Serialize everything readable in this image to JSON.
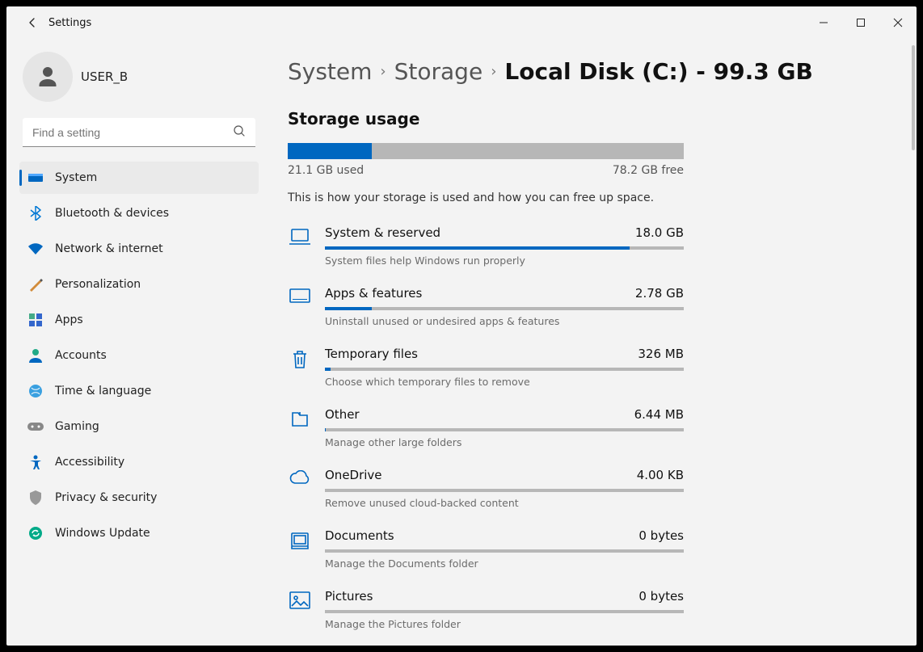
{
  "app_title": "Settings",
  "user": {
    "name": "USER_B"
  },
  "search": {
    "placeholder": "Find a setting"
  },
  "sidebar": {
    "items": [
      {
        "label": "System"
      },
      {
        "label": "Bluetooth & devices"
      },
      {
        "label": "Network & internet"
      },
      {
        "label": "Personalization"
      },
      {
        "label": "Apps"
      },
      {
        "label": "Accounts"
      },
      {
        "label": "Time & language"
      },
      {
        "label": "Gaming"
      },
      {
        "label": "Accessibility"
      },
      {
        "label": "Privacy & security"
      },
      {
        "label": "Windows Update"
      }
    ]
  },
  "breadcrumb": [
    {
      "text": "System"
    },
    {
      "text": "Storage"
    },
    {
      "text": "Local Disk (C:) - 99.3 GB"
    }
  ],
  "usage": {
    "section_title": "Storage usage",
    "used_label": "21.1 GB used",
    "free_label": "78.2 GB free",
    "desc": "This is how your storage is used and how you can free up space.",
    "fill_pct": 21.2
  },
  "categories": [
    {
      "title": "System & reserved",
      "size": "18.0 GB",
      "pct": 85,
      "desc": "System files help Windows run properly",
      "icon": "laptop"
    },
    {
      "title": "Apps & features",
      "size": "2.78 GB",
      "pct": 13,
      "desc": "Uninstall unused or undesired apps & features",
      "icon": "apps"
    },
    {
      "title": "Temporary files",
      "size": "326 MB",
      "pct": 1.5,
      "desc": "Choose which temporary files to remove",
      "icon": "trash"
    },
    {
      "title": "Other",
      "size": "6.44 MB",
      "pct": 0.2,
      "desc": "Manage other large folders",
      "icon": "folder"
    },
    {
      "title": "OneDrive",
      "size": "4.00 KB",
      "pct": 0,
      "desc": "Remove unused cloud-backed content",
      "icon": "cloud"
    },
    {
      "title": "Documents",
      "size": "0 bytes",
      "pct": 0,
      "desc": "Manage the Documents folder",
      "icon": "document"
    },
    {
      "title": "Pictures",
      "size": "0 bytes",
      "pct": 0,
      "desc": "Manage the Pictures folder",
      "icon": "picture"
    }
  ]
}
